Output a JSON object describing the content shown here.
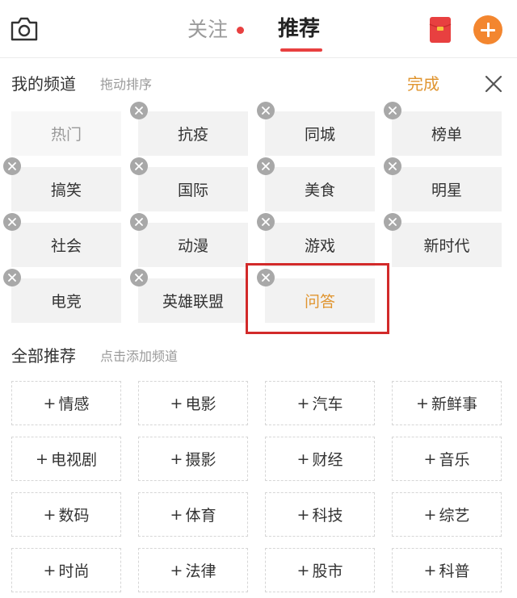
{
  "header": {
    "tab_follow": "关注",
    "tab_recommend": "推荐",
    "colors": {
      "accent": "#e84040",
      "orange": "#f3862f",
      "done": "#e09530"
    }
  },
  "my_channels": {
    "title": "我的频道",
    "hint": "拖动排序",
    "done_label": "完成",
    "items": [
      "热门",
      "抗疫",
      "同城",
      "榜单",
      "搞笑",
      "国际",
      "美食",
      "明星",
      "社会",
      "动漫",
      "游戏",
      "新时代",
      "电竞",
      "英雄联盟",
      "问答"
    ]
  },
  "all_channels": {
    "title": "全部推荐",
    "hint": "点击添加频道",
    "add_symbol": "+",
    "items": [
      "情感",
      "电影",
      "汽车",
      "新鲜事",
      "电视剧",
      "摄影",
      "财经",
      "音乐",
      "数码",
      "体育",
      "科技",
      "综艺",
      "时尚",
      "法律",
      "股市",
      "科普"
    ]
  },
  "icons": {
    "camera": "camera-icon",
    "red_packet": "red-packet-icon",
    "add": "add-channel-icon",
    "close": "close-icon",
    "remove": "remove-channel-icon"
  }
}
